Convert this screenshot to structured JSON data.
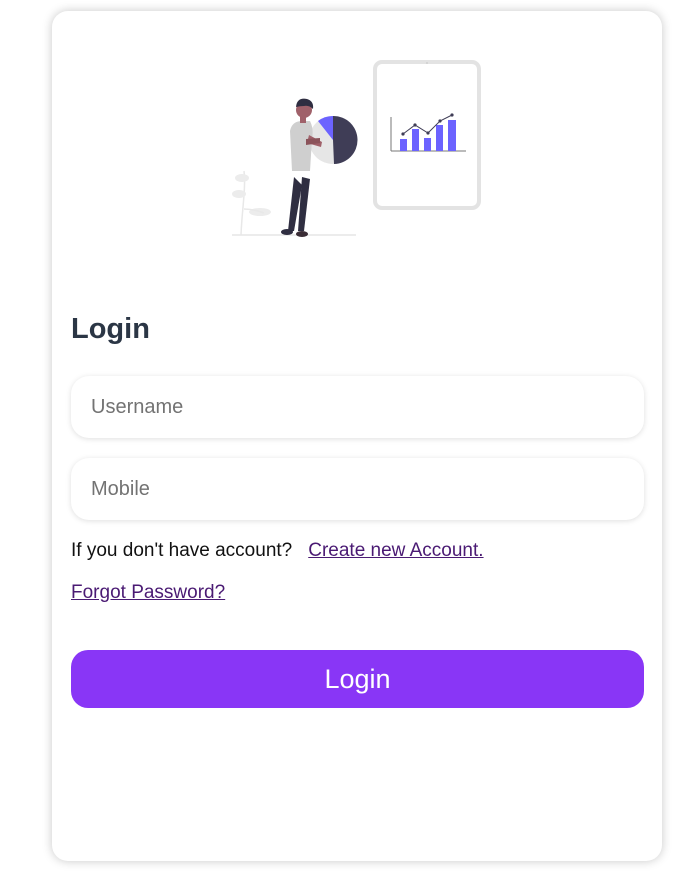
{
  "form": {
    "title": "Login",
    "username_placeholder": "Username",
    "mobile_placeholder": "Mobile",
    "no_account_text": "If you don't have account?",
    "create_account_link": "Create new Account.",
    "forgot_password_link": "Forgot Password?",
    "login_button": "Login"
  },
  "colors": {
    "accent": "#8936f6",
    "link": "#4a1a73",
    "chart_bars": "#6c63ff"
  },
  "illustration": {
    "icon": "person-analytics-illustration"
  }
}
